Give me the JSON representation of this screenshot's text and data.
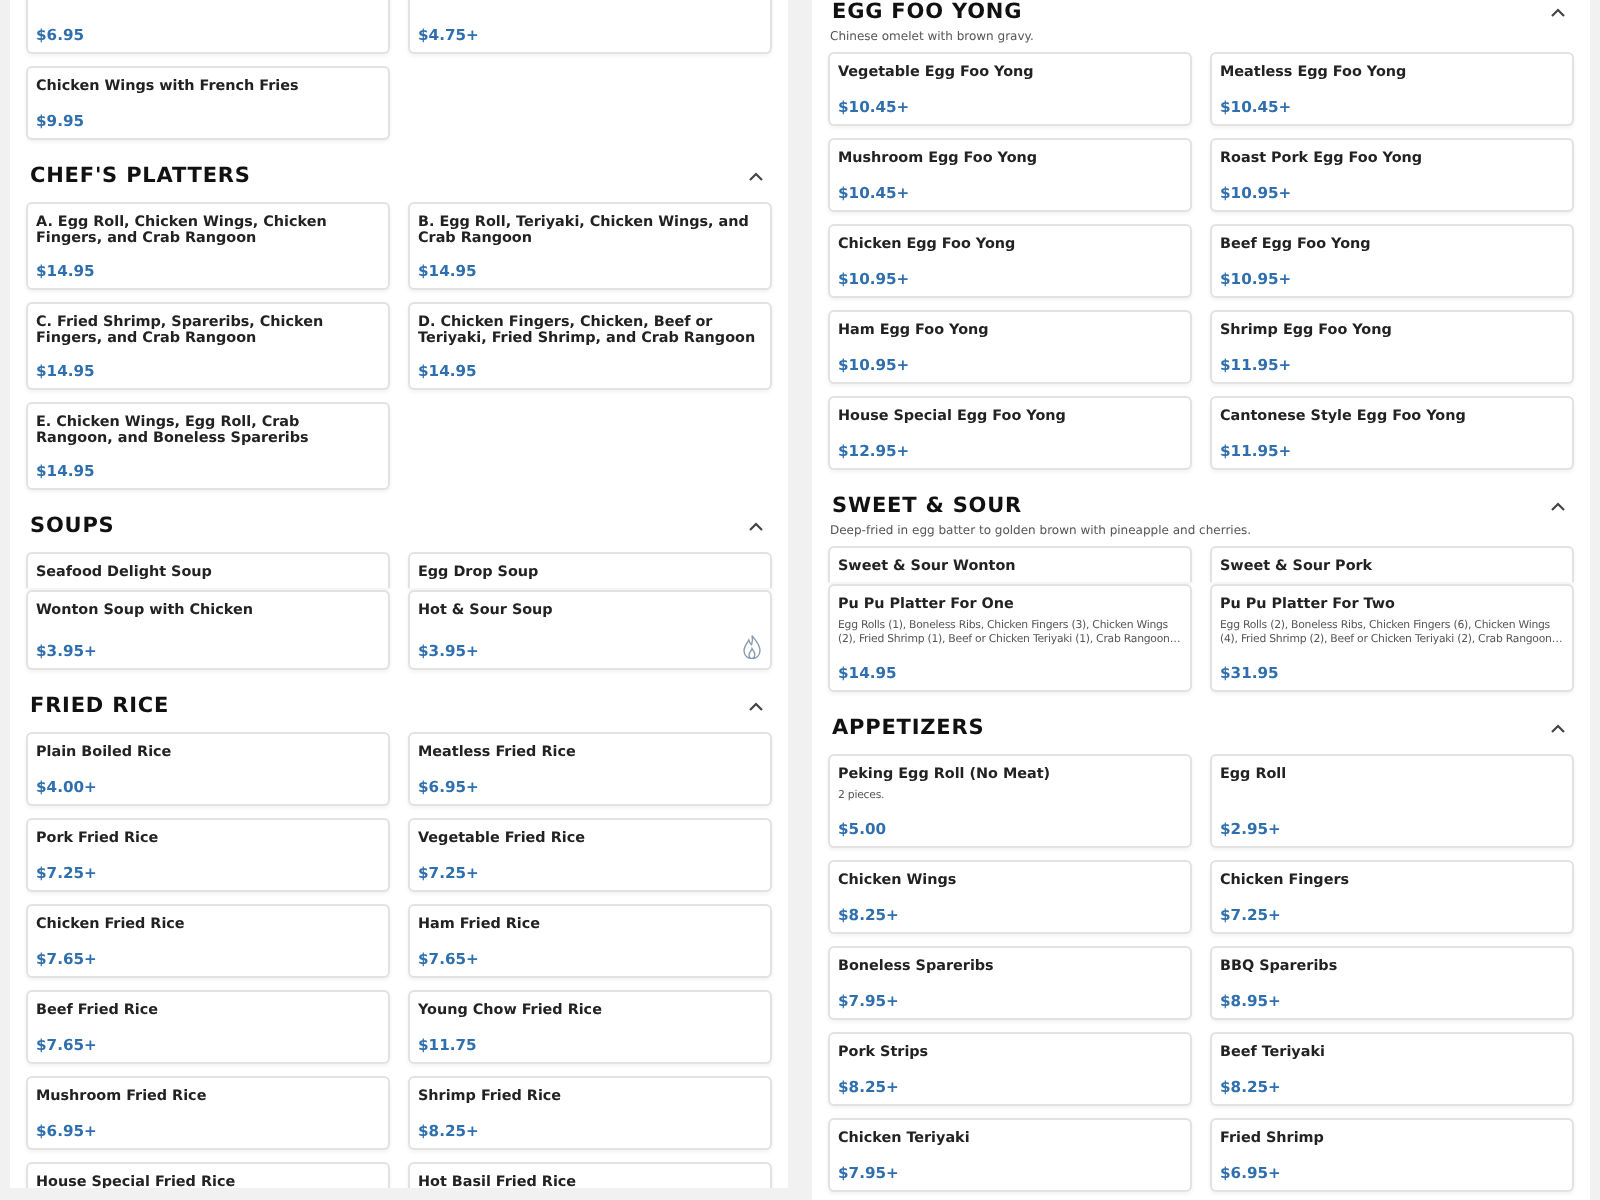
{
  "left_column": {
    "sections": [
      {
        "items": [
          {
            "price": "$6.95"
          },
          {
            "price": "$4.75+"
          },
          {
            "name": "Chicken Wings with French Fries",
            "price": "$9.95"
          }
        ]
      },
      {
        "title": "CHEF'S PLATTERS",
        "expanded": true,
        "items": [
          {
            "name": "A. Egg Roll, Chicken Wings, Chicken Fingers, and Crab Rangoon",
            "price": "$14.95"
          },
          {
            "name": "B. Egg Roll, Teriyaki, Chicken Wings, and Crab Rangoon",
            "price": "$14.95"
          },
          {
            "name": "C. Fried Shrimp, Spareribs, Chicken Fingers, and Crab Rangoon",
            "price": "$14.95"
          },
          {
            "name": "D. Chicken Fingers, Chicken, Beef or Teriyaki, Fried Shrimp, and Crab Rangoon",
            "price": "$14.95"
          },
          {
            "name": "E. Chicken Wings, Egg Roll, Crab Rangoon, and Boneless Spareribs",
            "price": "$14.95"
          }
        ]
      },
      {
        "title": "SOUPS",
        "expanded": true,
        "items": [
          {
            "name": "Seafood Delight Soup"
          },
          {
            "name": "Egg Drop Soup"
          },
          {
            "name": "Wonton Soup with Chicken",
            "price": "$3.95+",
            "spicy": false
          },
          {
            "name": "Hot & Sour Soup",
            "price": "$3.95+",
            "spicy": true
          }
        ]
      },
      {
        "title": "FRIED RICE",
        "expanded": true,
        "items": [
          {
            "name": "Plain Boiled Rice",
            "price": "$4.00+"
          },
          {
            "name": "Meatless Fried Rice",
            "price": "$6.95+"
          },
          {
            "name": "Pork Fried Rice",
            "price": "$7.25+"
          },
          {
            "name": "Vegetable Fried Rice",
            "price": "$7.25+"
          },
          {
            "name": "Chicken Fried Rice",
            "price": "$7.65+"
          },
          {
            "name": "Ham Fried Rice",
            "price": "$7.65+"
          },
          {
            "name": "Beef Fried Rice",
            "price": "$7.65+"
          },
          {
            "name": "Young Chow Fried Rice",
            "price": "$11.75"
          },
          {
            "name": "Mushroom Fried Rice",
            "price": "$6.95+"
          },
          {
            "name": "Shrimp Fried Rice",
            "price": "$8.25+"
          },
          {
            "name": "House Special Fried Rice"
          },
          {
            "name": "Hot Basil Fried Rice"
          }
        ]
      }
    ]
  },
  "right_column": {
    "sections": [
      {
        "title": "EGG FOO YONG",
        "expanded": true,
        "description": "Chinese omelet with brown gravy.",
        "items": [
          {
            "name": "Vegetable Egg Foo Yong",
            "price": "$10.45+"
          },
          {
            "name": "Meatless Egg Foo Yong",
            "price": "$10.45+"
          },
          {
            "name": "Mushroom Egg Foo Yong",
            "price": "$10.45+"
          },
          {
            "name": "Roast Pork Egg Foo Yong",
            "price": "$10.95+"
          },
          {
            "name": "Chicken Egg Foo Yong",
            "price": "$10.95+"
          },
          {
            "name": "Beef Egg Foo Yong",
            "price": "$10.95+"
          },
          {
            "name": "Ham Egg Foo Yong",
            "price": "$10.95+"
          },
          {
            "name": "Shrimp Egg Foo Yong",
            "price": "$11.95+"
          },
          {
            "name": "House Special Egg Foo Yong",
            "price": "$12.95+"
          },
          {
            "name": "Cantonese Style Egg Foo Yong",
            "price": "$11.95+"
          }
        ]
      },
      {
        "title": "SWEET & SOUR",
        "expanded": true,
        "description": "Deep-fried in egg batter to golden brown with pineapple and cherries.",
        "items": [
          {
            "name": "Sweet & Sour Wonton"
          },
          {
            "name": "Sweet & Sour Pork"
          },
          {
            "name": "Pu Pu Platter For One",
            "description": "Egg Rolls (1), Boneless Ribs, Chicken Fingers (3), Chicken Wings (2), Fried Shrimp (1), Beef or Chicken Teriyaki (1), Crab Rangoon…",
            "price": "$14.95"
          },
          {
            "name": "Pu Pu Platter For Two",
            "description": "Egg Rolls (2), Boneless Ribs, Chicken Fingers (6), Chicken Wings (4), Fried Shrimp (2), Beef or Chicken Teriyaki (2), Crab Rangoon…",
            "price": "$31.95"
          }
        ]
      },
      {
        "title": "APPETIZERS",
        "expanded": true,
        "items": [
          {
            "name": "Peking Egg Roll (No Meat)",
            "description": "2 pieces.",
            "price": "$5.00"
          },
          {
            "name": "Egg Roll",
            "price": "$2.95+"
          },
          {
            "name": "Chicken Wings",
            "price": "$8.25+"
          },
          {
            "name": "Chicken Fingers",
            "price": "$7.25+"
          },
          {
            "name": "Boneless Spareribs",
            "price": "$7.95+"
          },
          {
            "name": "BBQ Spareribs",
            "price": "$8.95+"
          },
          {
            "name": "Pork Strips",
            "price": "$8.25+"
          },
          {
            "name": "Beef Teriyaki",
            "price": "$8.25+"
          },
          {
            "name": "Chicken Teriyaki",
            "price": "$7.95+"
          },
          {
            "name": "Fried Shrimp",
            "price": "$6.95+"
          }
        ]
      }
    ]
  }
}
